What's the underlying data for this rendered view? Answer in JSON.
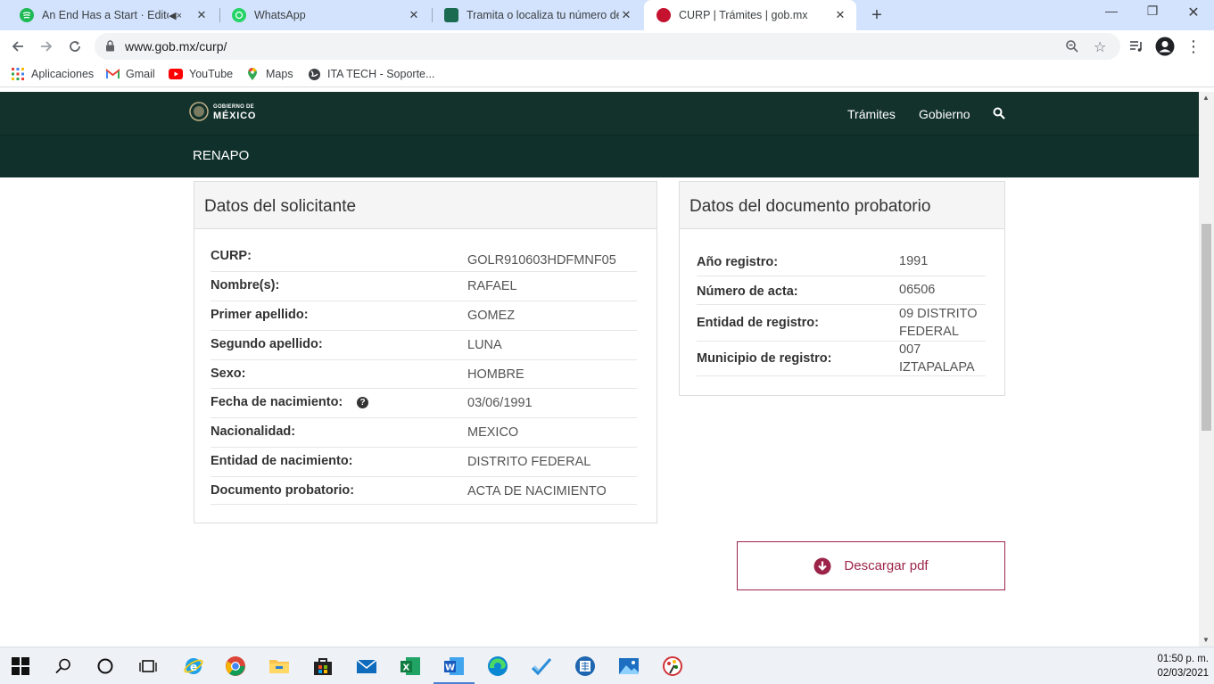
{
  "browser": {
    "tabs": [
      {
        "title": "An End Has a Start · Editors",
        "favicon": "spotify-icon",
        "color": "#1db954"
      },
      {
        "title": "WhatsApp",
        "favicon": "whatsapp-icon",
        "color": "#25d366"
      },
      {
        "title": "Tramita o localiza tu número de s",
        "favicon": "gob-seal-icon",
        "color": "#1a6b4f"
      },
      {
        "title": "CURP | Trámites | gob.mx",
        "favicon": "gob-red-icon",
        "color": "#c4122f"
      }
    ],
    "url": "www.gob.mx/curp/",
    "bookmarks": [
      {
        "label": "Aplicaciones",
        "icon": "apps-grid-icon"
      },
      {
        "label": "Gmail",
        "icon": "gmail-icon"
      },
      {
        "label": "YouTube",
        "icon": "youtube-icon"
      },
      {
        "label": "Maps",
        "icon": "maps-pin-icon"
      },
      {
        "label": "ITA TECH - Soporte...",
        "icon": "globe-icon"
      }
    ]
  },
  "site": {
    "logo_top": "GOBIERNO DE",
    "logo_bottom": "MÉXICO",
    "nav": [
      "Trámites",
      "Gobierno"
    ],
    "section": "RENAPO"
  },
  "solicitante": {
    "title": "Datos del solicitante",
    "rows": [
      {
        "label": "CURP:",
        "value": "GOLR910603HDFMNF05"
      },
      {
        "label": "Nombre(s):",
        "value": "RAFAEL"
      },
      {
        "label": "Primer apellido:",
        "value": "GOMEZ"
      },
      {
        "label": "Segundo apellido:",
        "value": "LUNA"
      },
      {
        "label": "Sexo:",
        "value": "HOMBRE"
      },
      {
        "label": "Fecha de nacimiento:",
        "value": "03/06/1991"
      },
      {
        "label": "Nacionalidad:",
        "value": "MEXICO"
      },
      {
        "label": "Entidad de nacimiento:",
        "value": "DISTRITO FEDERAL"
      },
      {
        "label": "Documento probatorio:",
        "value": "ACTA DE NACIMIENTO"
      }
    ]
  },
  "probatorio": {
    "title": "Datos del documento probatorio",
    "rows": [
      {
        "label": "Año registro:",
        "value": "1991"
      },
      {
        "label": "Número de acta:",
        "value": "06506"
      },
      {
        "label": "Entidad de registro:",
        "value": "09 DISTRITO FEDERAL"
      },
      {
        "label": "Municipio de registro:",
        "value": "007 IZTAPALAPA"
      }
    ]
  },
  "download_label": "Descargar pdf",
  "taskbar": {
    "time": "01:50 p. m.",
    "date": "02/03/2021"
  },
  "colors": {
    "gob_green": "#13322b",
    "gob_red": "#9d2449"
  }
}
